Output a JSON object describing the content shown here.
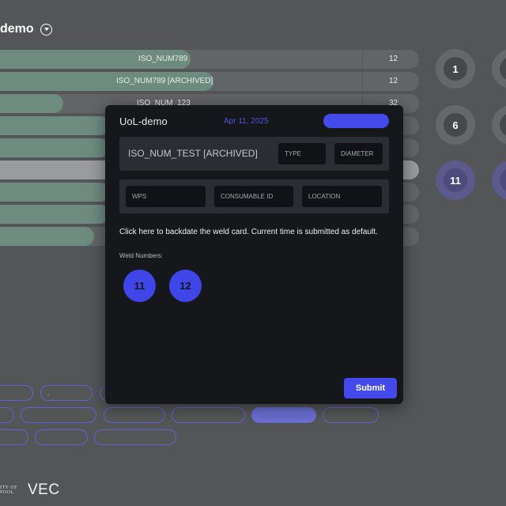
{
  "background": {
    "title": "demo",
    "rows": [
      {
        "label": "ISO_NUM789",
        "count": "12",
        "fill": 0.455
      },
      {
        "label": "ISO_NUM789 [ARCHIVED]",
        "count": "12",
        "fill": 0.509
      },
      {
        "label": "ISO_NUM_123",
        "count": "32",
        "fill": 0.15
      },
      {
        "label": "",
        "count": "",
        "fill": 0.26
      },
      {
        "label": "",
        "count": "",
        "fill": 0.26
      },
      {
        "label": "",
        "count": "",
        "fill": 0.0
      },
      {
        "label": "",
        "count": "",
        "fill": 0.26
      },
      {
        "label": "",
        "count": "",
        "fill": 0.26
      },
      {
        "label": "",
        "count": "",
        "fill": 0.225
      }
    ],
    "weld_circles": [
      "1",
      "6",
      "11"
    ],
    "pills_row1": [
      "",
      ".",
      ""
    ],
    "pills_row2": [
      "",
      "",
      "",
      "",
      "",
      ""
    ],
    "pills_row3": [
      "",
      "",
      ""
    ],
    "logo_text_line1": "ITY OF",
    "logo_text_line2": "POOL",
    "logo_brand": "VEC"
  },
  "modal": {
    "title": "UoL-demo",
    "date": "Apr 11, 2025",
    "iso_heading": "ISO_NUM_TEST [ARCHIVED]",
    "type_placeholder": "TYPE",
    "diameter_placeholder": "DIAMETER",
    "wps_placeholder": "WPS",
    "consumable_placeholder": "CONSUMABLE ID",
    "location_placeholder": "LOCATION",
    "backdate_hint": "Click here to backdate the weld card. Current time is submitted as default.",
    "weld_numbers_label": "Weld Numbers:",
    "weld_numbers": [
      "11",
      "12"
    ],
    "submit_label": "Submit"
  },
  "colors": {
    "accent": "#4449ea",
    "modal_bg": "#15171a",
    "page_bg": "#545556",
    "progress_fill": "#6e8b80"
  }
}
